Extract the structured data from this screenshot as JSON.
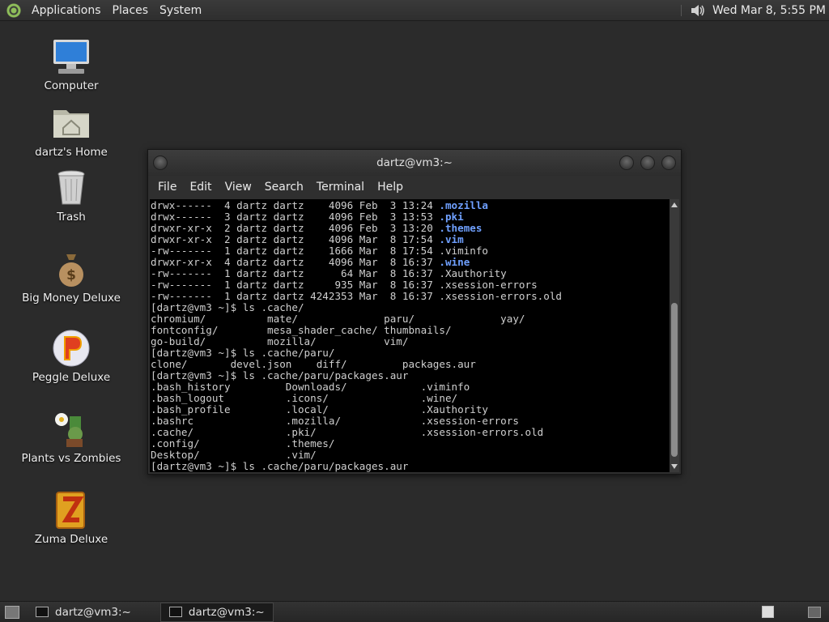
{
  "top_panel": {
    "menus": [
      "Applications",
      "Places",
      "System"
    ],
    "clock": "Wed Mar  8,  5:55 PM"
  },
  "desktop_icons": [
    {
      "label": "Computer"
    },
    {
      "label": "dartz's Home"
    },
    {
      "label": "Trash"
    },
    {
      "label": "Big Money Deluxe"
    },
    {
      "label": "Peggle Deluxe"
    },
    {
      "label": "Plants vs Zombies"
    },
    {
      "label": "Zuma Deluxe"
    }
  ],
  "terminal": {
    "title": "dartz@vm3:~",
    "menus": [
      "File",
      "Edit",
      "View",
      "Search",
      "Terminal",
      "Help"
    ],
    "lines": [
      {
        "text": "drwx------  4 dartz dartz    4096 Feb  3 13:24 ",
        "dir": ".mozilla"
      },
      {
        "text": "drwx------  3 dartz dartz    4096 Feb  3 13:53 ",
        "dir": ".pki"
      },
      {
        "text": "drwxr-xr-x  2 dartz dartz    4096 Feb  3 13:20 ",
        "dir": ".themes"
      },
      {
        "text": "drwxr-xr-x  2 dartz dartz    4096 Mar  8 17:54 ",
        "dir": ".vim"
      },
      {
        "text": "-rw-------  1 dartz dartz    1666 Mar  8 17:54 .viminfo",
        "dir": ""
      },
      {
        "text": "drwxr-xr-x  4 dartz dartz    4096 Mar  8 16:37 ",
        "dir": ".wine"
      },
      {
        "text": "-rw-------  1 dartz dartz      64 Mar  8 16:37 .Xauthority",
        "dir": ""
      },
      {
        "text": "-rw-------  1 dartz dartz     935 Mar  8 16:37 .xsession-errors",
        "dir": ""
      },
      {
        "text": "-rw-------  1 dartz dartz 4242353 Mar  8 16:37 .xsession-errors.old",
        "dir": ""
      },
      {
        "text": "[dartz@vm3 ~]$ ls .cache/",
        "dir": ""
      },
      {
        "text": "chromium/          mate/              paru/              yay/",
        "dir": ""
      },
      {
        "text": "fontconfig/        mesa_shader_cache/ thumbnails/",
        "dir": ""
      },
      {
        "text": "go-build/          mozilla/           vim/",
        "dir": ""
      },
      {
        "text": "[dartz@vm3 ~]$ ls .cache/paru/",
        "dir": ""
      },
      {
        "text": "clone/       devel.json    diff/         packages.aur",
        "dir": ""
      },
      {
        "text": "[dartz@vm3 ~]$ ls .cache/paru/packages.aur",
        "dir": ""
      },
      {
        "text": ".bash_history         Downloads/            .viminfo",
        "dir": ""
      },
      {
        "text": ".bash_logout          .icons/               .wine/",
        "dir": ""
      },
      {
        "text": ".bash_profile         .local/               .Xauthority",
        "dir": ""
      },
      {
        "text": ".bashrc               .mozilla/             .xsession-errors",
        "dir": ""
      },
      {
        "text": ".cache/               .pki/                 .xsession-errors.old",
        "dir": ""
      },
      {
        "text": ".config/              .themes/",
        "dir": ""
      },
      {
        "text": "Desktop/              .vim/",
        "dir": ""
      },
      {
        "text": "[dartz@vm3 ~]$ ls .cache/paru/packages.aur",
        "dir": ""
      }
    ]
  },
  "taskbar": {
    "tasks": [
      {
        "label": "dartz@vm3:~"
      },
      {
        "label": "dartz@vm3:~"
      }
    ]
  }
}
